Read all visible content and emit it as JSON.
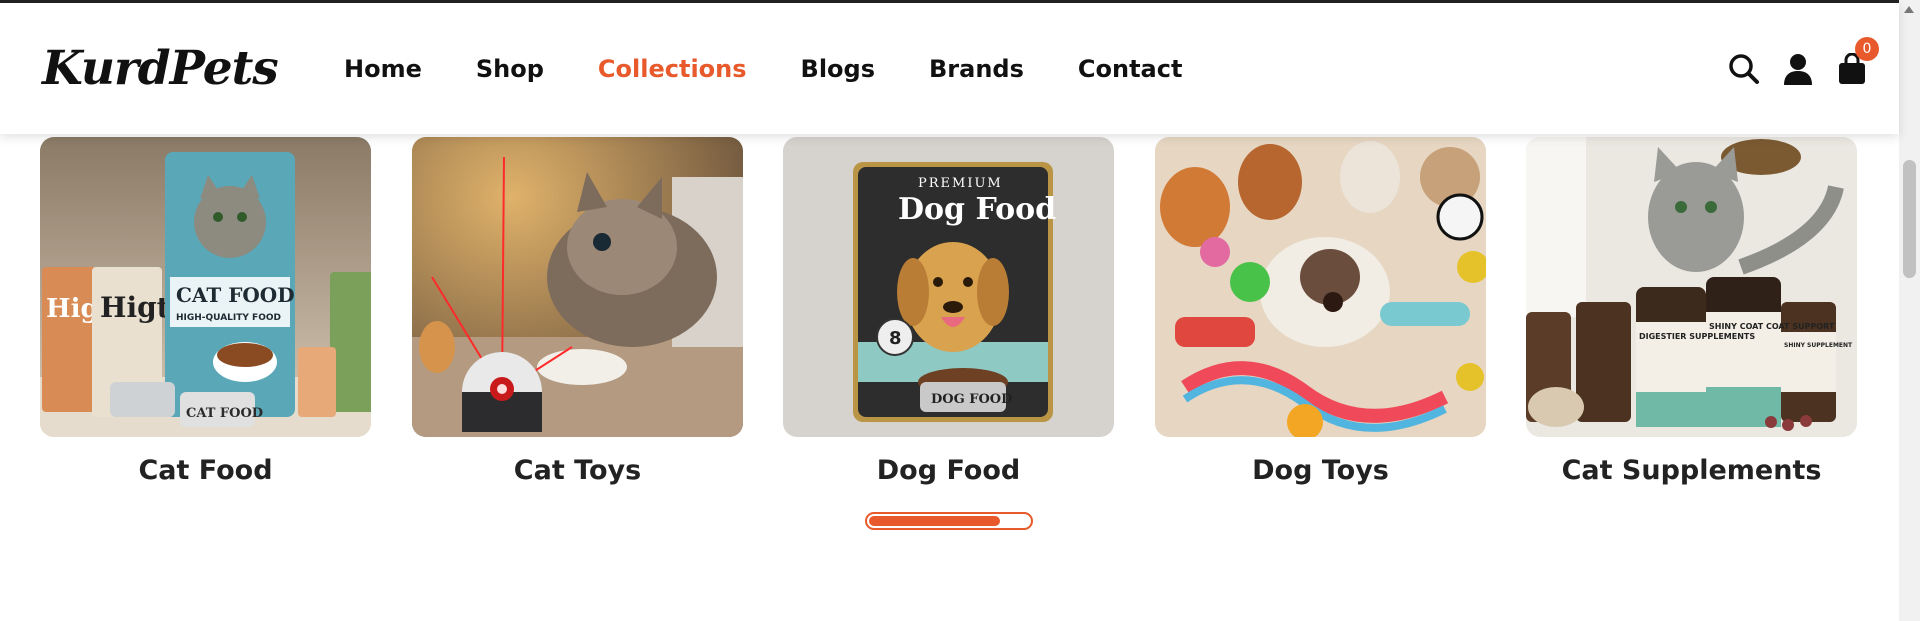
{
  "brand": {
    "logo_text": "KurdPets"
  },
  "nav": {
    "items": [
      {
        "label": "Home",
        "active": false
      },
      {
        "label": "Shop",
        "active": false
      },
      {
        "label": "Collections",
        "active": true
      },
      {
        "label": "Blogs",
        "active": false
      },
      {
        "label": "Brands",
        "active": false
      },
      {
        "label": "Contact",
        "active": false
      }
    ]
  },
  "header_icons": {
    "search": "search-icon",
    "account": "user-icon",
    "cart": "shopping-bag-icon",
    "cart_count": "0"
  },
  "collections": [
    {
      "title": "Cat Food",
      "image": "cat-food-image",
      "img_text": [
        "CAT FOOD",
        "HIGH-QUALITY FOOD",
        "Higt",
        "CAT FOOD"
      ]
    },
    {
      "title": "Cat Toys",
      "image": "cat-toys-image",
      "img_text": []
    },
    {
      "title": "Dog Food",
      "image": "dog-food-image",
      "img_text": [
        "PREMIUM",
        "Dog Food",
        "DOG FOOD"
      ]
    },
    {
      "title": "Dog Toys",
      "image": "dog-toys-image",
      "img_text": []
    },
    {
      "title": "Cat Supplements",
      "image": "cat-supplements-image",
      "img_text": [
        "DIGESTIER SUPPLEMENTS",
        "SHINY COAT COAT SUPPORT",
        "SHINY SUPPLEMENT"
      ]
    }
  ],
  "carousel_progress": 0.82,
  "colors": {
    "accent": "#e8592b",
    "text": "#111111"
  }
}
